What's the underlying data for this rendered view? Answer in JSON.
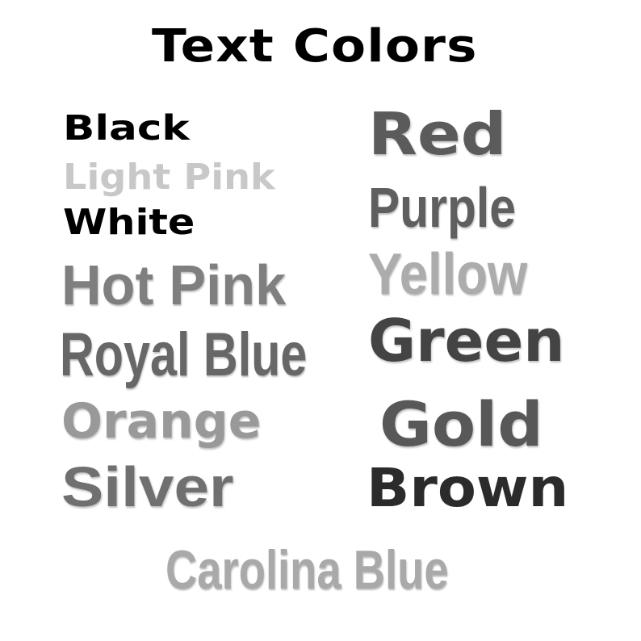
{
  "title": "Text Colors",
  "left_column": {
    "black": "Black",
    "light_pink": "Light Pink",
    "white": "White",
    "hot_pink": "Hot Pink",
    "royal_blue": "Royal Blue",
    "orange": "Orange",
    "silver": "Silver"
  },
  "right_column": {
    "red": "Red",
    "purple": "Purple",
    "yellow": "Yellow",
    "green": "Green",
    "gold": "Gold",
    "brown": "Brown"
  },
  "bottom": {
    "carolina_blue": "Carolina Blue"
  },
  "colors": {
    "background": "#ffffff",
    "title": "#000000",
    "black": "#000000",
    "light_pink": "#c8c8c8",
    "white": "#000000",
    "hot_pink": "#7f7f7f",
    "royal_blue": "#676767",
    "orange": "#999999",
    "silver": "#707070",
    "red": "#5b5b5b",
    "purple": "#5f5f5f",
    "yellow": "#acacac",
    "green": "#444444",
    "gold": "#585858",
    "brown": "#2b2b2b",
    "carolina_blue": "#a9a9a9"
  }
}
